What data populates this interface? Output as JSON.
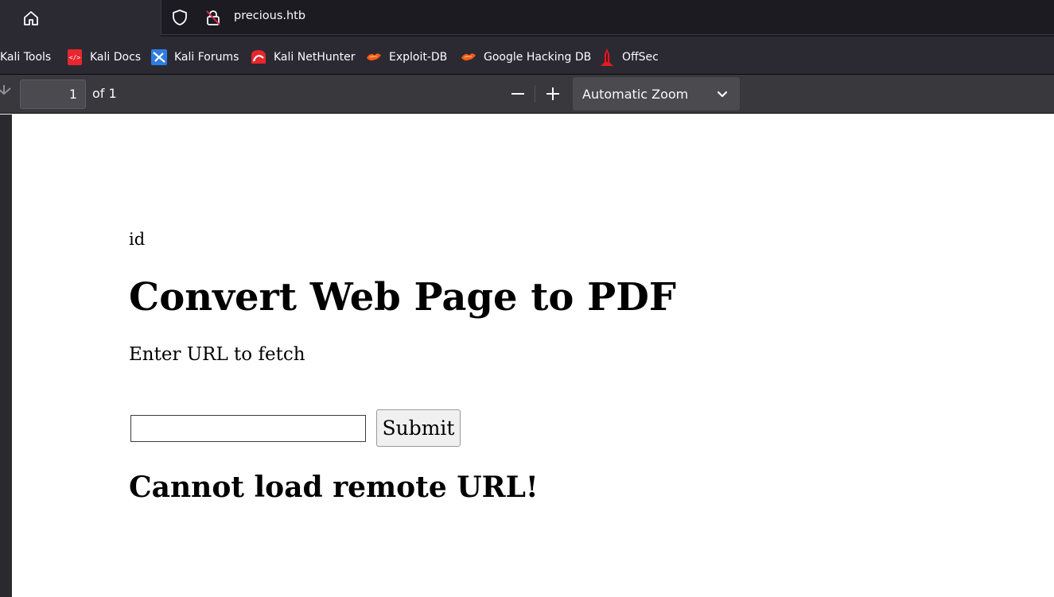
{
  "browser": {
    "url": "precious.htb"
  },
  "bookmarks": [
    {
      "label": "Kali Tools",
      "icon": "kali-tools-icon"
    },
    {
      "label": "Kali Docs",
      "icon": "kali-docs-icon"
    },
    {
      "label": "Kali Forums",
      "icon": "kali-forums-icon"
    },
    {
      "label": "Kali NetHunter",
      "icon": "kali-nethunter-icon"
    },
    {
      "label": "Exploit-DB",
      "icon": "exploit-db-icon"
    },
    {
      "label": "Google Hacking DB",
      "icon": "google-hacking-db-icon"
    },
    {
      "label": "OffSec",
      "icon": "offsec-icon"
    }
  ],
  "pdf_toolbar": {
    "page_number": "1",
    "page_of": "of 1",
    "zoom": "Automatic Zoom"
  },
  "document": {
    "command_text": "id",
    "heading": "Convert Web Page to PDF",
    "prompt": "Enter URL to fetch",
    "url_input_value": "",
    "submit_label": "Submit",
    "error": "Cannot load remote URL!"
  },
  "colors": {
    "chrome_dark": "#1c1b22",
    "chrome_mid": "#2b2a33",
    "pdf_toolbar": "#38383d",
    "kali_red": "#e8262e",
    "kali_blue": "#2f7de1",
    "exploit_orange": "#ff5c1a"
  }
}
